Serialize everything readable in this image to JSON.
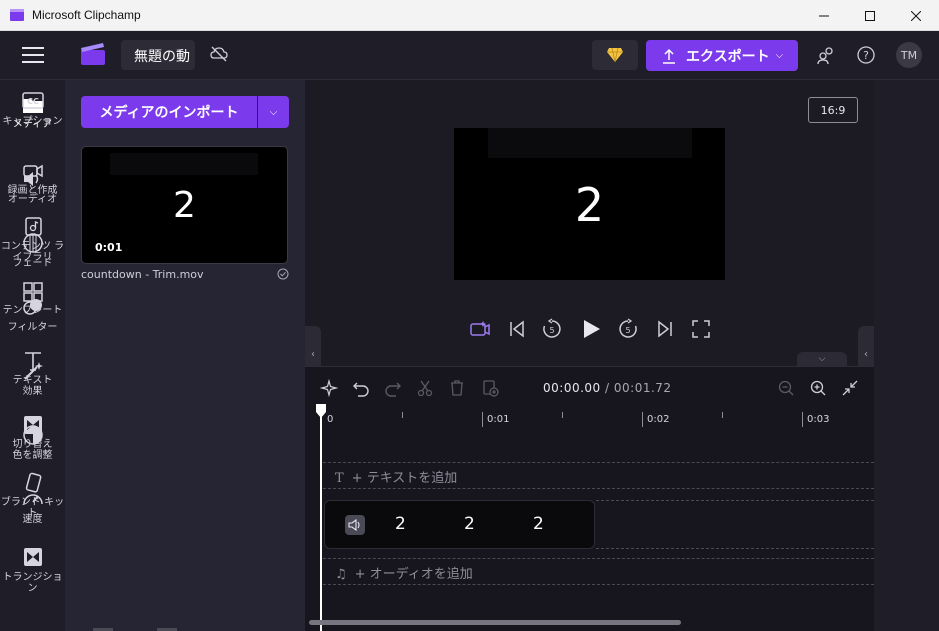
{
  "window": {
    "title": "Microsoft Clipchamp"
  },
  "header": {
    "project_name": "無題の動",
    "export_label": "エクスポート",
    "avatar_initials": "TM"
  },
  "leftnav": {
    "items": [
      {
        "label": "メディア"
      },
      {
        "label": "録画と作成"
      },
      {
        "label": "コンテンツ ライブラリ"
      },
      {
        "label": "テンプレート"
      },
      {
        "label": "テキスト"
      },
      {
        "label": "切り替え"
      },
      {
        "label": "ブランド キット"
      }
    ]
  },
  "media": {
    "import_label": "メディアのインポート",
    "item": {
      "thumb_text": "2",
      "duration": "0:01",
      "filename": "countdown - Trim.mov"
    }
  },
  "preview": {
    "aspect": "16:9",
    "frame_text": "2"
  },
  "rightnav": {
    "items": [
      {
        "label": "キャプション"
      },
      {
        "label": "オーディオ"
      },
      {
        "label": "フェード"
      },
      {
        "label": "フィルター"
      },
      {
        "label": "効果"
      },
      {
        "label": "色を調整"
      },
      {
        "label": "速度"
      },
      {
        "label": "トランジション"
      }
    ]
  },
  "timeline": {
    "current": "00:00.00",
    "separator": "/",
    "total": "00:01.72",
    "ruler": [
      "0",
      "0:01",
      "0:02",
      "0:03"
    ],
    "text_track_label": "+ テキストを追加",
    "audio_track_label": "+ オーディオを追加",
    "clip_frames": [
      "2",
      "2",
      "2"
    ]
  },
  "colors": {
    "accent": "#7c3aed",
    "background": "#1c1b24"
  }
}
